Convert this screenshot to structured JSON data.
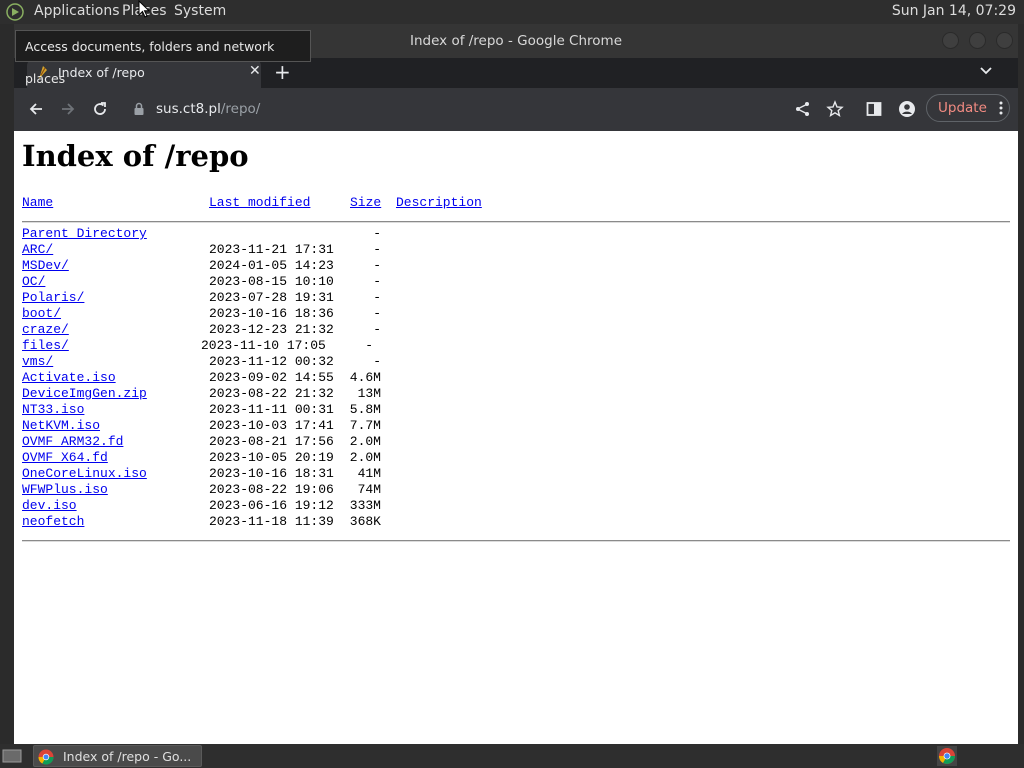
{
  "top_panel": {
    "menus": [
      "Applications",
      "Places",
      "System"
    ],
    "clock": "Sun Jan 14, 07:29"
  },
  "tooltip": "Access documents, folders and network places",
  "window": {
    "title": "Index of /repo - Google Chrome"
  },
  "tab": {
    "title": "Index of /repo",
    "close_glyph": "✕",
    "new_tab_glyph": "+"
  },
  "toolbar": {
    "url_host": "sus.ct8.pl",
    "url_path": "/repo/",
    "update_label": "Update"
  },
  "page": {
    "heading": "Index of /repo",
    "columns": {
      "name": "Name",
      "last_modified": "Last modified",
      "size": "Size",
      "description": "Description"
    },
    "parent": {
      "name": "Parent Directory",
      "size": "-"
    },
    "rows": [
      {
        "name": "ARC/",
        "date": "2023-11-21 17:31",
        "size": "-"
      },
      {
        "name": "MSDev/",
        "date": "2024-01-05 14:23",
        "size": "-"
      },
      {
        "name": "OC/",
        "date": "2023-08-15 10:10",
        "size": "-"
      },
      {
        "name": "Polaris/",
        "date": "2023-07-28 19:31",
        "size": "-"
      },
      {
        "name": "boot/",
        "date": "2023-10-16 18:36",
        "size": "-"
      },
      {
        "name": "craze/",
        "date": "2023-12-23 21:32",
        "size": "-"
      },
      {
        "name": "files/",
        "date": "2023-11-10 17:05",
        "size": "-"
      },
      {
        "name": "vms/",
        "date": "2023-11-12 00:32",
        "size": "-"
      },
      {
        "name": "Activate.iso",
        "date": "2023-09-02 14:55",
        "size": "4.6M"
      },
      {
        "name": "DeviceImgGen.zip",
        "date": "2023-08-22 21:32",
        "size": "13M"
      },
      {
        "name": "NT33.iso",
        "date": "2023-11-11 00:31",
        "size": "5.8M"
      },
      {
        "name": "NetKVM.iso",
        "date": "2023-10-03 17:41",
        "size": "7.7M"
      },
      {
        "name": "OVMF_ARM32.fd",
        "date": "2023-08-21 17:56",
        "size": "2.0M"
      },
      {
        "name": "OVMF_X64.fd",
        "date": "2023-10-05 20:19",
        "size": "2.0M"
      },
      {
        "name": "OneCoreLinux.iso",
        "date": "2023-10-16 18:31",
        "size": "41M"
      },
      {
        "name": "WFWPlus.iso",
        "date": "2023-08-22 19:06",
        "size": "74M"
      },
      {
        "name": "dev.iso",
        "date": "2023-06-16 19:12",
        "size": "333M"
      },
      {
        "name": "neofetch",
        "date": "2023-11-18 11:39",
        "size": "368K"
      }
    ]
  },
  "taskbar": {
    "task_label": "Index of /repo - Go..."
  }
}
